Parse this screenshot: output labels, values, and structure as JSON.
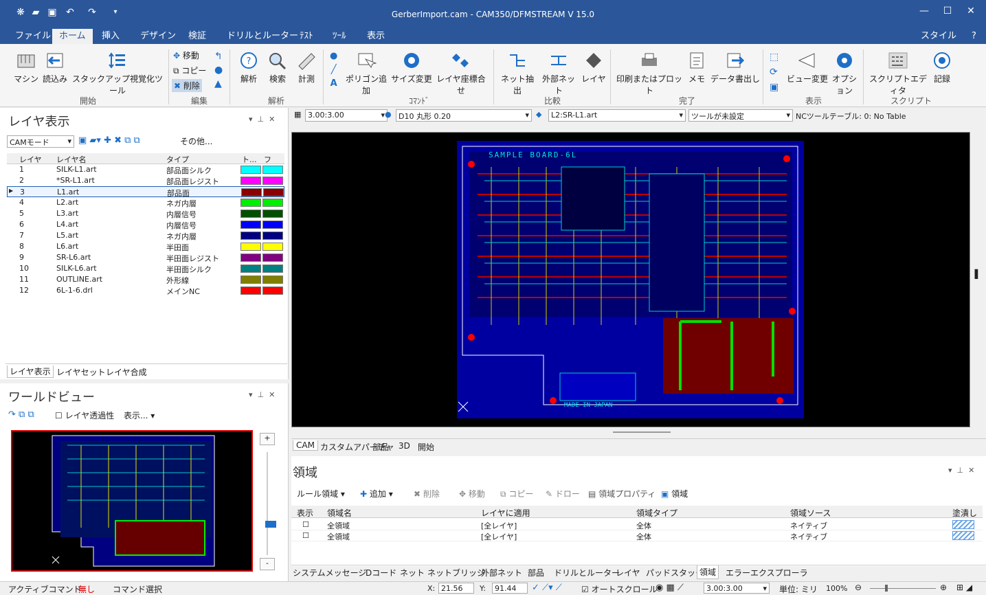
{
  "app": {
    "title": "GerberImport.cam - CAM350/DFMSTREAM V 15.0",
    "style": "スタイル"
  },
  "menu": [
    "ファイル",
    "ホーム",
    "挿入",
    "デザイン",
    "検証",
    "ドリルとルーター",
    "ﾃｽﾄ",
    "ﾂｰﾙ",
    "表示"
  ],
  "ribbon": {
    "machine": "マシン",
    "load": "読込み",
    "stackup": "スタックアップ視覚化ツール",
    "move": "移動",
    "copy": "コピー",
    "delete": "削除",
    "analyze": "解析",
    "search": "検索",
    "measure": "計測",
    "polygon": "ポリゴン追加",
    "resize": "サイズ変更",
    "align": "レイヤ座標合せ",
    "netextract": "ネット抽出",
    "extnet": "外部ネット",
    "layer": "レイヤ",
    "print": "印刷またはプロット",
    "memo": "メモ",
    "dataout": "データ書出し",
    "viewchange": "ビュー変更",
    "option": "オプション",
    "scripteditor": "スクリプトエディタ",
    "record": "記録",
    "groups": [
      "開始",
      "編集",
      "解析",
      "ｺﾏﾝﾄﾞ",
      "比較",
      "完了",
      "表示",
      "スクリプト"
    ]
  },
  "toolbar2": {
    "scale": "3.00:3.00",
    "dcode": "D10  丸形 0.20",
    "layer": "L2:SR-L1.art",
    "tool": "ツールが未設定",
    "nc": "NCツールテーブル: 0: No Table"
  },
  "layer_panel": {
    "title": "レイヤ表示",
    "mode": "CAMモード",
    "other": "その他...",
    "headers": [
      "レイヤ",
      "レイヤ名",
      "タイプ",
      "ト...",
      "フラ..."
    ],
    "rows": [
      {
        "n": "1",
        "name": "SILK-L1.art",
        "type": "部品面シルク",
        "c": "#00ffff"
      },
      {
        "n": "2",
        "name": "*SR-L1.art",
        "type": "部品面レジスト",
        "c": "#ff00ff"
      },
      {
        "n": "3",
        "name": "L1.art",
        "type": "部品面",
        "c": "#8b0000"
      },
      {
        "n": "4",
        "name": "L2.art",
        "type": "ネガ内層",
        "c": "#00ee00"
      },
      {
        "n": "5",
        "name": "L3.art",
        "type": "内層信号",
        "c": "#005000"
      },
      {
        "n": "6",
        "name": "L4.art",
        "type": "内層信号",
        "c": "#0000ff"
      },
      {
        "n": "7",
        "name": "L5.art",
        "type": "ネガ内層",
        "c": "#000080"
      },
      {
        "n": "8",
        "name": "L6.art",
        "type": "半田面",
        "c": "#ffff00"
      },
      {
        "n": "9",
        "name": "SR-L6.art",
        "type": "半田面レジスト",
        "c": "#800080"
      },
      {
        "n": "10",
        "name": "SILK-L6.art",
        "type": "半田面シルク",
        "c": "#008080"
      },
      {
        "n": "11",
        "name": "OUTLINE.art",
        "type": "外形線",
        "c": "#808000"
      },
      {
        "n": "12",
        "name": "6L-1-6.drl",
        "type": "メインNC",
        "c": "#ff0000"
      }
    ],
    "tabs": [
      "レイヤ表示",
      "レイヤセット",
      "レイヤ合成"
    ]
  },
  "world": {
    "title": "ワールドビュー",
    "transparency": "レイヤ透過性",
    "display": "表示..."
  },
  "canvas": {
    "board_title": "SAMPLE BOARD-6L",
    "made_in": "MADE IN JAPAN",
    "tabs": [
      "CAM",
      "カスタムアパーチャ",
      "部品",
      "3D",
      "開始"
    ]
  },
  "region": {
    "title": "領域",
    "rule": "ルール領域",
    "add": "追加",
    "del": "削除",
    "move": "移動",
    "copy": "コピー",
    "draw": "ドロー",
    "prop": "領域プロパティ",
    "region": "領域",
    "headers": [
      "表示",
      "領域名",
      "レイヤに適用",
      "領域タイプ",
      "領域ソース",
      "塗潰し"
    ],
    "rows": [
      {
        "name": "全領域",
        "layer": "[全レイヤ]",
        "type": "全体",
        "source": "ネイティブ"
      },
      {
        "name": "全領域",
        "layer": "[全レイヤ]",
        "type": "全体",
        "source": "ネイティブ"
      }
    ]
  },
  "bottom_tabs": [
    "システムメッセージ",
    "Dコード",
    "ネット",
    "ネットブリッジ",
    "外部ネット",
    "部品",
    "ドリルとルーター",
    "レイヤ",
    "パッドスタック",
    "領域",
    "エラーエクスプローラ"
  ],
  "status": {
    "active_label": "アクティブコマンド:",
    "active_value": "無し",
    "cmd": "コマンド選択",
    "x_label": "X:",
    "x": "21.56",
    "y_label": "Y:",
    "y": "91.44",
    "autoscroll": "オートスクロール",
    "scale": "3.00:3.00",
    "unit": "単位: ミリ",
    "zoom": "100%"
  }
}
